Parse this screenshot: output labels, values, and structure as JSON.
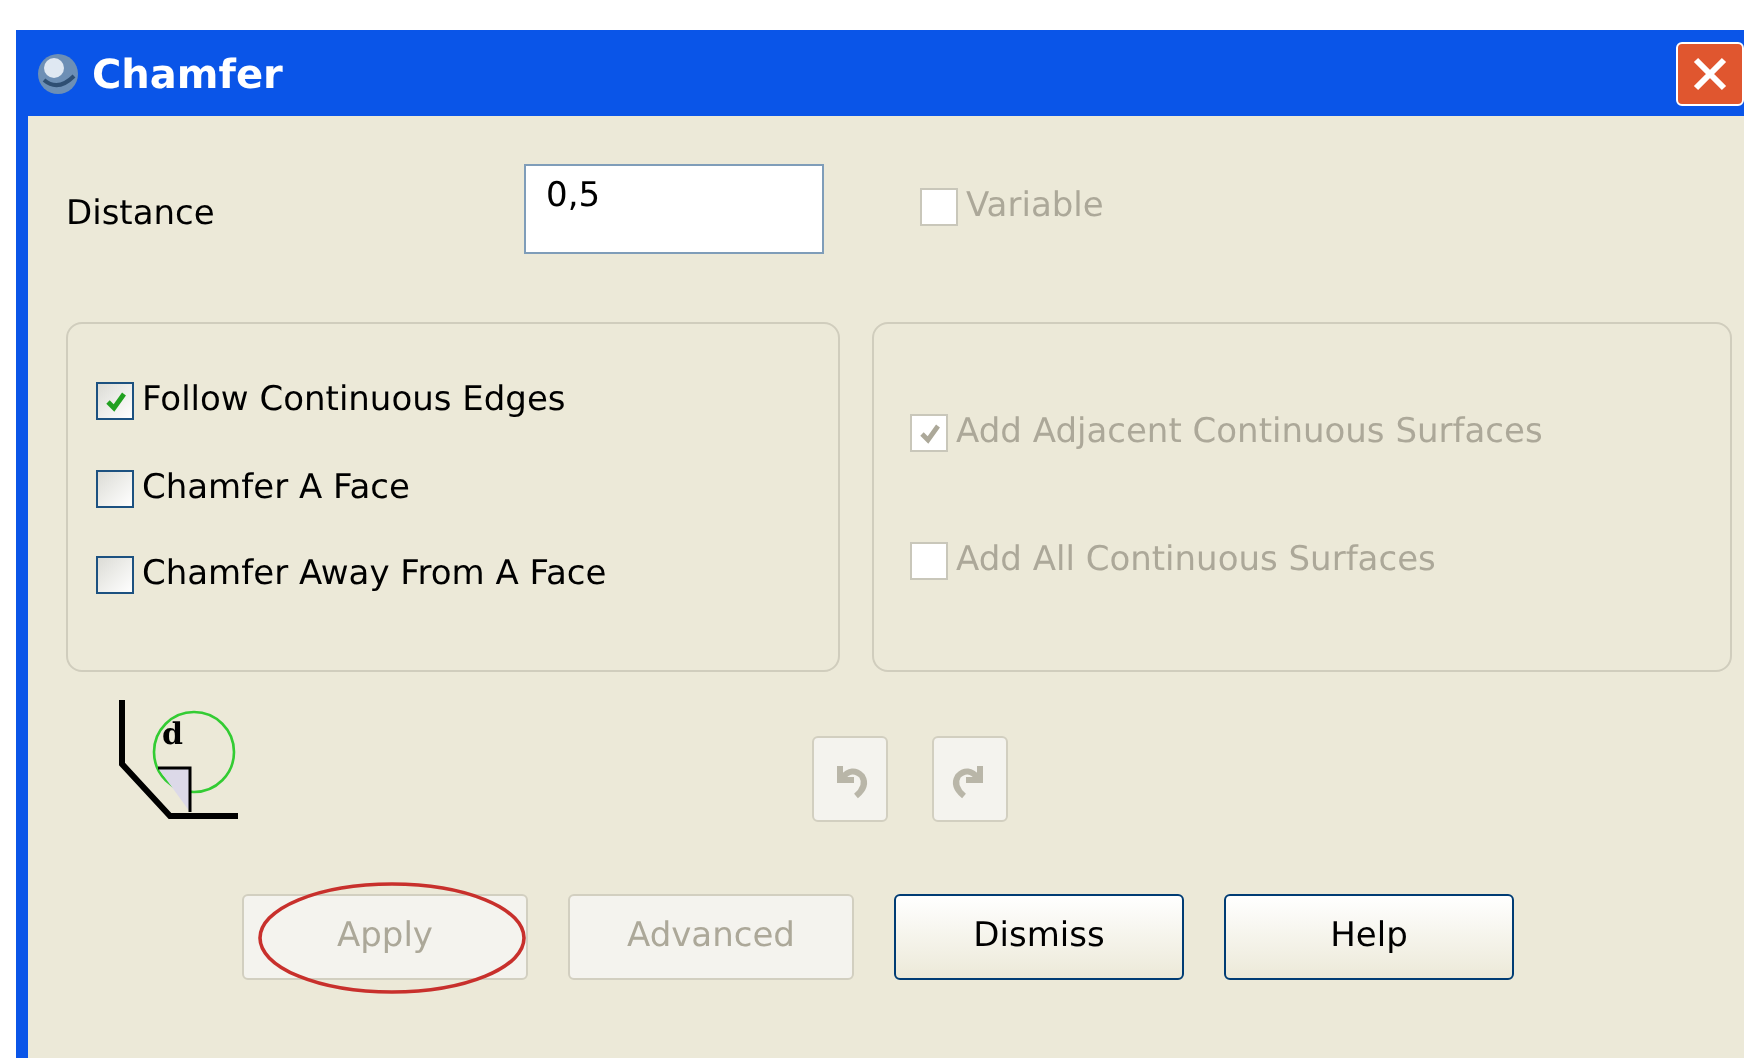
{
  "window": {
    "title": "Chamfer"
  },
  "distance": {
    "label": "Distance",
    "value": "0,5"
  },
  "variable": {
    "label": "Variable",
    "checked": false,
    "disabled": true
  },
  "left_options": [
    {
      "label": "Follow Continuous Edges",
      "checked": true,
      "disabled": false
    },
    {
      "label": "Chamfer A Face",
      "checked": false,
      "disabled": false
    },
    {
      "label": "Chamfer Away From A Face",
      "checked": false,
      "disabled": false
    }
  ],
  "right_options": [
    {
      "label": "Add Adjacent Continuous Surfaces",
      "checked": true,
      "disabled": true
    },
    {
      "label": "Add All Continuous Surfaces",
      "checked": false,
      "disabled": true
    }
  ],
  "diagram": {
    "label": "d"
  },
  "history_buttons": [
    {
      "kind": "undo",
      "disabled": true
    },
    {
      "kind": "redo",
      "disabled": true
    }
  ],
  "buttons": [
    {
      "label": "Apply",
      "disabled": true,
      "circled": true
    },
    {
      "label": "Advanced",
      "disabled": true,
      "circled": false
    },
    {
      "label": "Dismiss",
      "disabled": false,
      "circled": false
    },
    {
      "label": "Help",
      "disabled": false,
      "circled": false
    }
  ]
}
